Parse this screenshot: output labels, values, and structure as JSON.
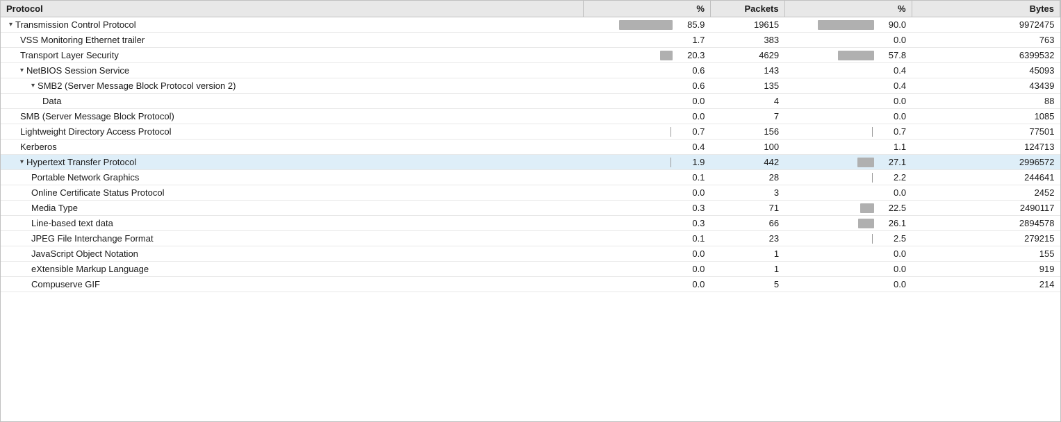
{
  "table": {
    "columns": [
      {
        "id": "protocol",
        "label": "Protocol"
      },
      {
        "id": "percent_tx",
        "label": "%",
        "align": "right"
      },
      {
        "id": "packets",
        "label": "Packets",
        "align": "right"
      },
      {
        "id": "percent_rx",
        "label": "%",
        "align": "right"
      },
      {
        "id": "bytes",
        "label": "Bytes",
        "align": "right"
      }
    ],
    "rows": [
      {
        "id": "tcp",
        "indent": 0,
        "expandable": true,
        "expanded": true,
        "highlighted": false,
        "name": "Transmission Control Protocol",
        "percent_tx": "85.9",
        "bar_tx": 86,
        "packets": "19615",
        "percent_rx": "90.0",
        "bar_rx": 90,
        "bytes": "9972475"
      },
      {
        "id": "vss",
        "indent": 1,
        "expandable": false,
        "expanded": false,
        "highlighted": false,
        "name": "VSS Monitoring Ethernet trailer",
        "percent_tx": "1.7",
        "bar_tx": 0,
        "packets": "383",
        "percent_rx": "0.0",
        "bar_rx": 0,
        "bytes": "763"
      },
      {
        "id": "tls",
        "indent": 1,
        "expandable": false,
        "expanded": false,
        "highlighted": false,
        "name": "Transport Layer Security",
        "percent_tx": "20.3",
        "bar_tx": 20,
        "packets": "4629",
        "percent_rx": "57.8",
        "bar_rx": 58,
        "bytes": "6399532"
      },
      {
        "id": "netbios",
        "indent": 1,
        "expandable": true,
        "expanded": true,
        "highlighted": false,
        "name": "NetBIOS Session Service",
        "percent_tx": "0.6",
        "bar_tx": 0,
        "packets": "143",
        "percent_rx": "0.4",
        "bar_rx": 0,
        "bytes": "45093"
      },
      {
        "id": "smb2",
        "indent": 2,
        "expandable": true,
        "expanded": true,
        "highlighted": false,
        "name": "SMB2 (Server Message Block Protocol version 2)",
        "percent_tx": "0.6",
        "bar_tx": 0,
        "packets": "135",
        "percent_rx": "0.4",
        "bar_rx": 0,
        "bytes": "43439"
      },
      {
        "id": "data",
        "indent": 3,
        "expandable": false,
        "expanded": false,
        "highlighted": false,
        "name": "Data",
        "percent_tx": "0.0",
        "bar_tx": 0,
        "packets": "4",
        "percent_rx": "0.0",
        "bar_rx": 0,
        "bytes": "88"
      },
      {
        "id": "smb",
        "indent": 1,
        "expandable": false,
        "expanded": false,
        "highlighted": false,
        "name": "SMB (Server Message Block Protocol)",
        "percent_tx": "0.0",
        "bar_tx": 0,
        "packets": "7",
        "percent_rx": "0.0",
        "bar_rx": 0,
        "bytes": "1085"
      },
      {
        "id": "ldap",
        "indent": 1,
        "expandable": false,
        "expanded": false,
        "highlighted": false,
        "name": "Lightweight Directory Access Protocol",
        "percent_tx": "0.7",
        "bar_tx": 0,
        "packets": "156",
        "percent_rx": "0.7",
        "bar_rx": 0,
        "bytes": "77501",
        "tick_tx": true,
        "tick_rx": true
      },
      {
        "id": "kerberos",
        "indent": 1,
        "expandable": false,
        "expanded": false,
        "highlighted": false,
        "name": "Kerberos",
        "percent_tx": "0.4",
        "bar_tx": 0,
        "packets": "100",
        "percent_rx": "1.1",
        "bar_rx": 0,
        "bytes": "124713"
      },
      {
        "id": "http",
        "indent": 1,
        "expandable": true,
        "expanded": true,
        "highlighted": true,
        "name": "Hypertext Transfer Protocol",
        "percent_tx": "1.9",
        "bar_tx": 0,
        "packets": "442",
        "percent_rx": "27.1",
        "bar_rx": 27,
        "bytes": "2996572",
        "tick_tx": true
      },
      {
        "id": "png",
        "indent": 2,
        "expandable": false,
        "expanded": false,
        "highlighted": false,
        "name": "Portable Network Graphics",
        "percent_tx": "0.1",
        "bar_tx": 0,
        "packets": "28",
        "percent_rx": "2.2",
        "bar_rx": 0,
        "bytes": "244641",
        "tick_rx": true
      },
      {
        "id": "ocsp",
        "indent": 2,
        "expandable": false,
        "expanded": false,
        "highlighted": false,
        "name": "Online Certificate Status Protocol",
        "percent_tx": "0.0",
        "bar_tx": 0,
        "packets": "3",
        "percent_rx": "0.0",
        "bar_rx": 0,
        "bytes": "2452"
      },
      {
        "id": "mediatype",
        "indent": 2,
        "expandable": false,
        "expanded": false,
        "highlighted": false,
        "name": "Media Type",
        "percent_tx": "0.3",
        "bar_tx": 0,
        "packets": "71",
        "percent_rx": "22.5",
        "bar_rx": 22,
        "bytes": "2490117"
      },
      {
        "id": "linetext",
        "indent": 2,
        "expandable": false,
        "expanded": false,
        "highlighted": false,
        "name": "Line-based text data",
        "percent_tx": "0.3",
        "bar_tx": 0,
        "packets": "66",
        "percent_rx": "26.1",
        "bar_rx": 26,
        "bytes": "2894578"
      },
      {
        "id": "jpeg",
        "indent": 2,
        "expandable": false,
        "expanded": false,
        "highlighted": false,
        "name": "JPEG File Interchange Format",
        "percent_tx": "0.1",
        "bar_tx": 0,
        "packets": "23",
        "percent_rx": "2.5",
        "bar_rx": 0,
        "bytes": "279215",
        "tick_rx": true
      },
      {
        "id": "json",
        "indent": 2,
        "expandable": false,
        "expanded": false,
        "highlighted": false,
        "name": "JavaScript Object Notation",
        "percent_tx": "0.0",
        "bar_tx": 0,
        "packets": "1",
        "percent_rx": "0.0",
        "bar_rx": 0,
        "bytes": "155"
      },
      {
        "id": "xml",
        "indent": 2,
        "expandable": false,
        "expanded": false,
        "highlighted": false,
        "name": "eXtensible Markup Language",
        "percent_tx": "0.0",
        "bar_tx": 0,
        "packets": "1",
        "percent_rx": "0.0",
        "bar_rx": 0,
        "bytes": "919"
      },
      {
        "id": "gif",
        "indent": 2,
        "expandable": false,
        "expanded": false,
        "highlighted": false,
        "name": "Compuserve GIF",
        "percent_tx": "0.0",
        "bar_tx": 0,
        "packets": "5",
        "percent_rx": "0.0",
        "bar_rx": 0,
        "bytes": "214"
      }
    ]
  }
}
